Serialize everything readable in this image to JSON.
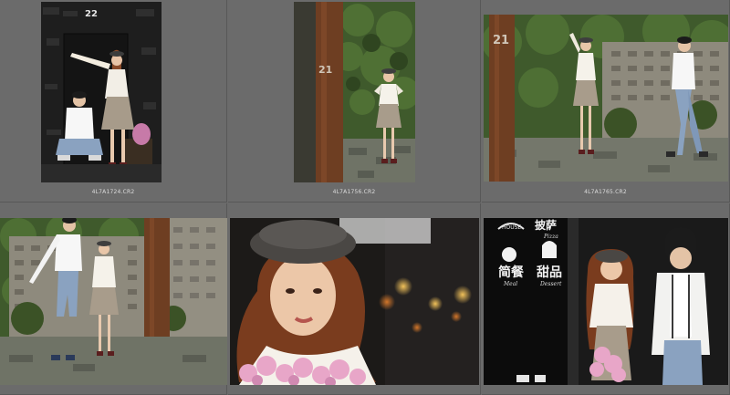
{
  "photos": [
    {
      "filename": "4L7A1724.CR2",
      "door_number": "22"
    },
    {
      "filename": "4L7A1756.CR2",
      "door_number": "21"
    },
    {
      "filename": "4L7A1765.CR2",
      "door_number": "21"
    },
    {
      "filename": "",
      "door_number": ""
    },
    {
      "filename": "",
      "door_number": ""
    },
    {
      "filename": "",
      "door_number": "",
      "signage": {
        "pizza_hanzi": "披萨",
        "pizza_en": "Pizza",
        "meal_hanzi": "简餐",
        "meal_en": "Meal",
        "dessert_hanzi": "甜品",
        "dessert_en": "Dessert",
        "house_text": "HOUSE"
      }
    }
  ]
}
